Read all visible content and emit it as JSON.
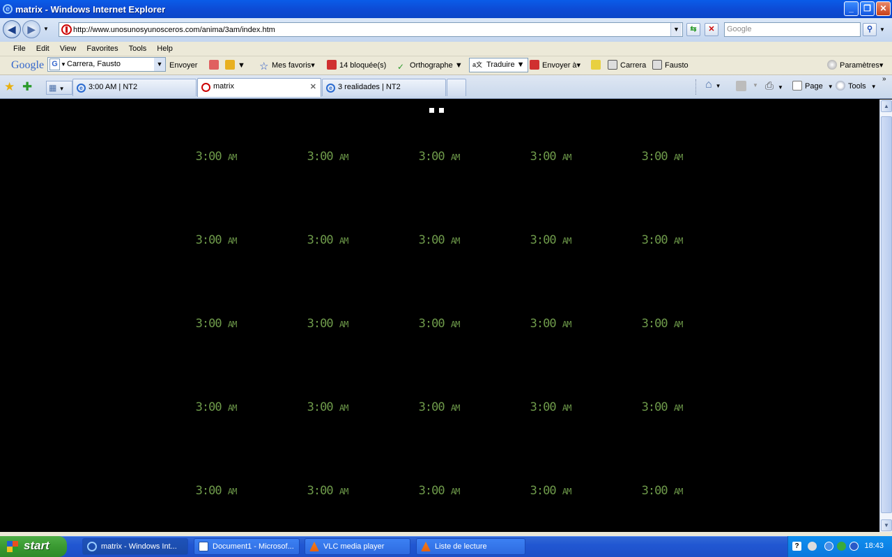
{
  "window": {
    "title": "matrix - Windows Internet Explorer"
  },
  "nav": {
    "url": "http://www.unosunosyunosceros.com/anima/3am/index.htm",
    "search_placeholder": "Google"
  },
  "menu": {
    "items": [
      "File",
      "Edit",
      "View",
      "Favorites",
      "Tools",
      "Help"
    ]
  },
  "google_bar": {
    "logo": "Google",
    "account": "Carrera, Fausto",
    "envoyer": "Envoyer",
    "mes_favoris": "Mes favoris",
    "bloquees": "14 bloquée(s)",
    "orthographe": "Orthographe",
    "traduire": "Traduire",
    "envoyer_a": "Envoyer à",
    "carrera": "Carrera",
    "fausto": "Fausto",
    "parametres": "Paramètres"
  },
  "tabs": [
    {
      "label": "3:00 AM | NT2",
      "active": false
    },
    {
      "label": "matrix",
      "active": true
    },
    {
      "label": "3 realidades | NT2",
      "active": false
    }
  ],
  "command_bar": {
    "page": "Page",
    "tools": "Tools"
  },
  "page": {
    "clock_text": "3:00",
    "clock_suffix": "AM",
    "grid_rows": 5,
    "grid_cols": 5,
    "clock_color": "#6e9a4a"
  },
  "taskbar": {
    "start": "start",
    "buttons": [
      "matrix - Windows Int...",
      "Document1 - Microsof...",
      "VLC media player",
      "Liste de lecture"
    ],
    "time": "18:43"
  }
}
